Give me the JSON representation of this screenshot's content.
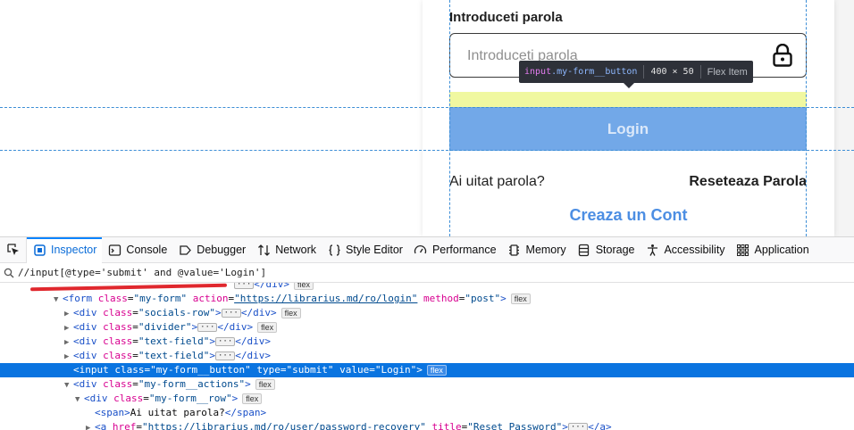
{
  "page": {
    "field_label": "Introduceti parola",
    "password_placeholder": "Introduceti parola",
    "login_label": "Login",
    "forgot_text": "Ai uitat parola?",
    "reset_label": "Reseteaza Parola",
    "create_label": "Creaza un Cont"
  },
  "tooltip": {
    "tag": "input",
    "class": ".my-form__button",
    "dimensions": "400 × 50",
    "layout": "Flex Item"
  },
  "devtools": {
    "tabs": [
      {
        "label": "Inspector",
        "icon": "inspector-icon"
      },
      {
        "label": "Console",
        "icon": "console-icon"
      },
      {
        "label": "Debugger",
        "icon": "debugger-icon"
      },
      {
        "label": "Network",
        "icon": "network-icon"
      },
      {
        "label": "Style Editor",
        "icon": "style-editor-icon"
      },
      {
        "label": "Performance",
        "icon": "performance-icon"
      },
      {
        "label": "Memory",
        "icon": "memory-icon"
      },
      {
        "label": "Storage",
        "icon": "storage-icon"
      },
      {
        "label": "Accessibility",
        "icon": "accessibility-icon"
      },
      {
        "label": "Application",
        "icon": "application-icon"
      }
    ],
    "search_value": "//input[@type='submit' and @value='Login']",
    "flex_badge": "flex",
    "tree": {
      "top_ellipsis": "···",
      "top_close": "</div>",
      "form_tag": "<form",
      "form_class_attr": "class",
      "form_class_val": "\"my-form\"",
      "form_action_attr": "action",
      "form_action_val": "\"https://librarius.md/ro/login\"",
      "form_method_attr": "method",
      "form_method_val": "\"post\"",
      "form_close": ">",
      "div_socials": "\"socials-row\"",
      "div_divider": "\"divider\"",
      "div_text1": "\"text-field\"",
      "div_text2": "\"text-field\"",
      "input_class": "\"my-form__button\"",
      "input_type": "\"submit\"",
      "input_value": "\"Login\"",
      "actions_class": "\"my-form__actions\"",
      "row_class": "\"my-form__row\"",
      "span_text": "Ai uitat parola?",
      "a_href": "\"https://librarius.md/ro/user/password-recovery\"",
      "a_title": "\"Reset Password\""
    }
  }
}
